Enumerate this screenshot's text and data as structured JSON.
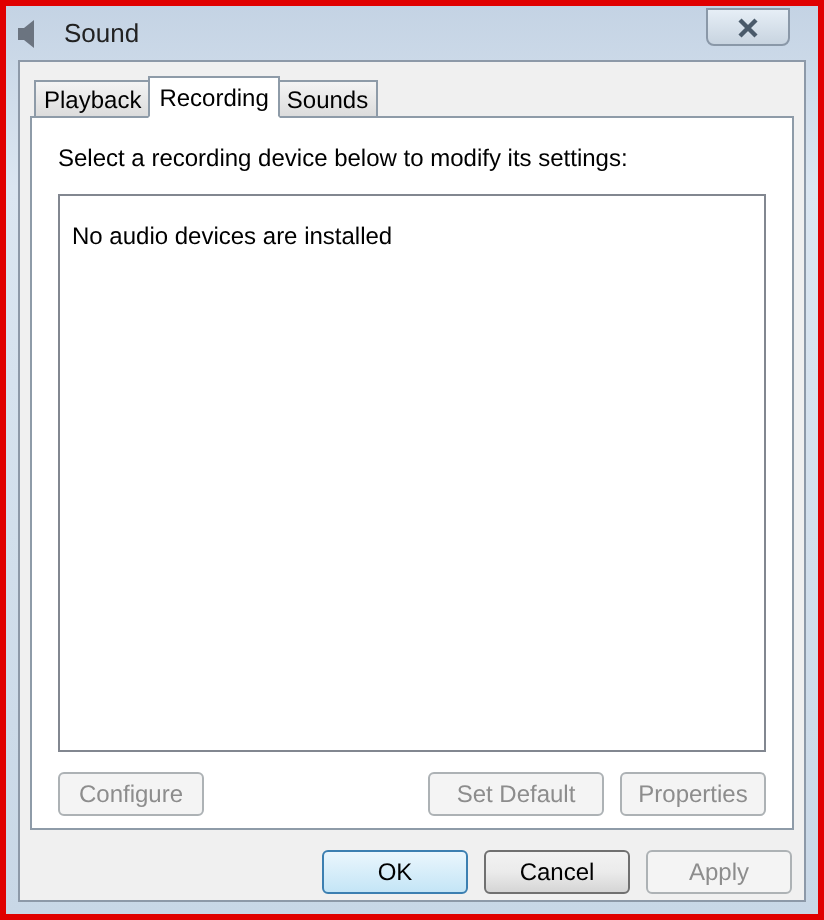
{
  "window": {
    "title": "Sound"
  },
  "tabs": [
    {
      "label": "Playback",
      "selected": false
    },
    {
      "label": "Recording",
      "selected": true
    },
    {
      "label": "Sounds",
      "selected": false
    }
  ],
  "instruction": "Select a recording device below to modify its settings:",
  "device_list": {
    "empty_message": "No audio devices are installed"
  },
  "device_buttons": [
    {
      "label": "Configure",
      "disabled": true
    },
    {
      "label": "Set Default",
      "disabled": true
    },
    {
      "label": "Properties",
      "disabled": true
    }
  ],
  "dialog_buttons": [
    {
      "label": "OK",
      "disabled": false,
      "default": true
    },
    {
      "label": "Cancel",
      "disabled": false,
      "default": false
    },
    {
      "label": "Apply",
      "disabled": true,
      "default": false
    }
  ]
}
